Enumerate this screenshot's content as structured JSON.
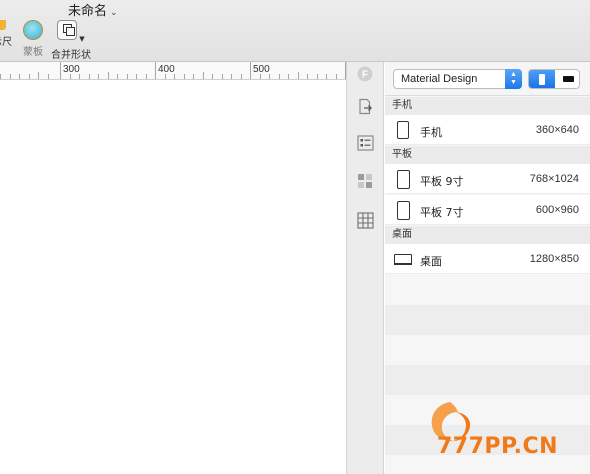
{
  "document": {
    "title": "未命名"
  },
  "toolbar": {
    "ruler_label": "标尺",
    "ruler_label_visible": "示尺",
    "mask_label": "蒙板",
    "merge_label": "合并形状"
  },
  "ruler": {
    "ticks": [
      "300",
      "400",
      "500"
    ]
  },
  "inspector": {
    "icons": [
      "forms-icon",
      "export-icon",
      "inspector-icon",
      "components-icon",
      "grid-icon"
    ]
  },
  "device_panel": {
    "design_select": "Material Design",
    "orientation": "portrait",
    "sections": [
      {
        "title": "手机",
        "devices": [
          {
            "name": "手机",
            "size": "360×640",
            "icon": "phone-icon"
          }
        ]
      },
      {
        "title": "平板",
        "devices": [
          {
            "name": "平板 9寸",
            "size": "768×1024",
            "icon": "tablet-icon"
          },
          {
            "name": "平板 7寸",
            "size": "600×960",
            "icon": "tablet-icon"
          }
        ]
      },
      {
        "title": "桌面",
        "devices": [
          {
            "name": "桌面",
            "size": "1280×850",
            "icon": "laptop-icon"
          }
        ]
      }
    ]
  },
  "watermark": {
    "text": "777PP.CN"
  },
  "colors": {
    "accent": "#1d78ea",
    "watermark": "#f07a1a"
  }
}
